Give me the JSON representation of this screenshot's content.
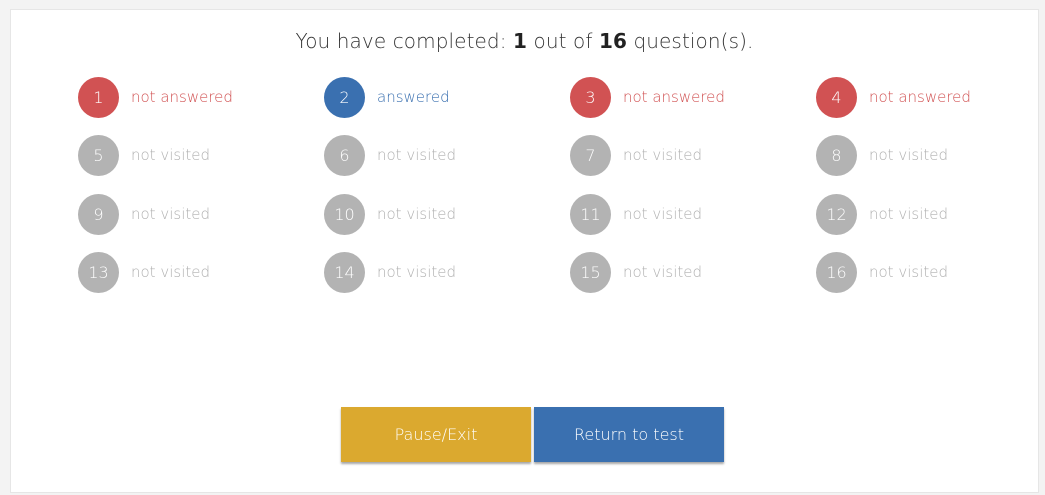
{
  "summary": {
    "prefix": "You have completed: ",
    "completed": "1",
    "middle": " out of ",
    "total": "16",
    "suffix": " question(s)."
  },
  "status_labels": {
    "not_answered": "not answered",
    "answered": "answered",
    "not_visited": "not visited"
  },
  "colors": {
    "not_answered": "#d15253",
    "answered": "#3a70b0",
    "not_visited": "#b3b3b3",
    "pause_button": "#dba92f",
    "return_button": "#3a70b0"
  },
  "questions": [
    {
      "number": "1",
      "status": "not_answered",
      "label": "not answered"
    },
    {
      "number": "2",
      "status": "answered",
      "label": "answered"
    },
    {
      "number": "3",
      "status": "not_answered",
      "label": "not answered"
    },
    {
      "number": "4",
      "status": "not_answered",
      "label": "not answered"
    },
    {
      "number": "5",
      "status": "not_visited",
      "label": "not visited"
    },
    {
      "number": "6",
      "status": "not_visited",
      "label": "not visited"
    },
    {
      "number": "7",
      "status": "not_visited",
      "label": "not visited"
    },
    {
      "number": "8",
      "status": "not_visited",
      "label": "not visited"
    },
    {
      "number": "9",
      "status": "not_visited",
      "label": "not visited"
    },
    {
      "number": "10",
      "status": "not_visited",
      "label": "not visited"
    },
    {
      "number": "11",
      "status": "not_visited",
      "label": "not visited"
    },
    {
      "number": "12",
      "status": "not_visited",
      "label": "not visited"
    },
    {
      "number": "13",
      "status": "not_visited",
      "label": "not visited"
    },
    {
      "number": "14",
      "status": "not_visited",
      "label": "not visited"
    },
    {
      "number": "15",
      "status": "not_visited",
      "label": "not visited"
    },
    {
      "number": "16",
      "status": "not_visited",
      "label": "not visited"
    }
  ],
  "buttons": {
    "pause_exit": "Pause/Exit",
    "return_to_test": "Return to test"
  }
}
